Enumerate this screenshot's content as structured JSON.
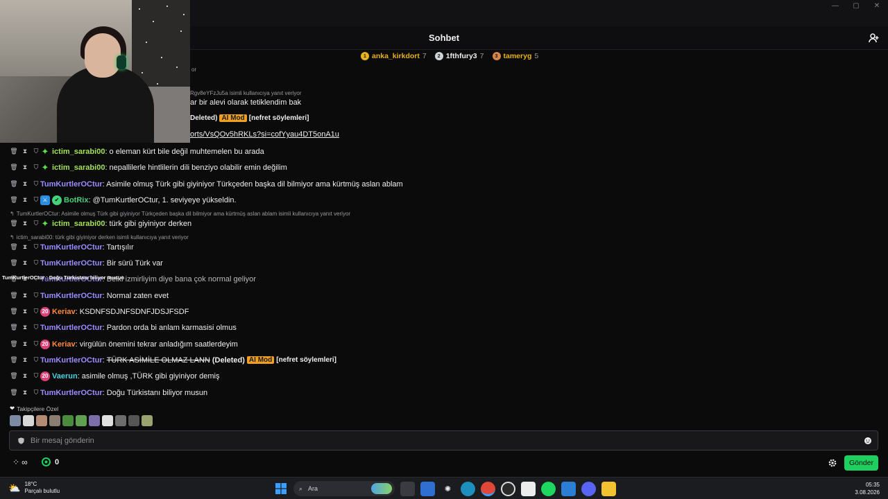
{
  "chat": {
    "title": "Sohbet",
    "leaders": [
      {
        "rank": "1",
        "name": "anka_kirkdort",
        "count": "7",
        "color": "#e8b21c"
      },
      {
        "rank": "2",
        "name": "1fthfury3",
        "count": "7",
        "color": "#cfd3d8"
      },
      {
        "rank": "3",
        "name": "tameryg",
        "count": "5",
        "color": "#d9864a"
      }
    ],
    "partial": {
      "top_tail": "or",
      "reply1": "Rgv8eYFzJu5a isimli kullanıcıya yanıt veriyor",
      "msg1": "ar bir alevi olarak tetiklendim bak",
      "deleted_label": "Deleted)",
      "link": "orts/VsQOv5hRKLs?si=cofYyau4DT5onA1u"
    },
    "messages": [
      {
        "user": "ictim_sarabi00",
        "text": ": o eleman kürt bile değil muhtemelen bu arada",
        "color": "#a4e05a"
      },
      {
        "user": "ictim_sarabi00",
        "text": ": nepallilerle hintlilerin dili benziyo olabilir emin değilim",
        "color": "#a4e05a"
      },
      {
        "user": "TumKurtlerOCtur",
        "text": ": Asimile olmuş Türk gibi giyiniyor Türkçeden başka dil bilmiyor ama kürtmüş aslan ablam",
        "color": "#9b8cff"
      },
      {
        "user": "BotRix",
        "text": ": @TumKurtlerOCtur, 1. seviyeye yükseldin.",
        "color": "#46d17c"
      },
      {
        "user": "ictim_sarabi00",
        "text": ": türk gibi giyiniyor derken",
        "color": "#a4e05a"
      },
      {
        "user": "TumKurtlerOCtur",
        "text": ": Tartışılır",
        "color": "#9b8cff"
      },
      {
        "user": "TumKurtlerOCtur",
        "text": ": Bir sürü Türk var",
        "color": "#9b8cff"
      },
      {
        "user": "TumKurtlerOCtur",
        "text": ": Belki izmirliyim diye bana çok normal geliyor",
        "color": "#9b8cff"
      },
      {
        "user": "TumKurtlerOCtur",
        "text": ": Normal zaten evet",
        "color": "#9b8cff"
      },
      {
        "user": "Keriav",
        "text": ": KSDNFSDJNFSDNFJDSJFSDF",
        "color": "#ff8a3d"
      },
      {
        "user": "TumKurtlerOCtur",
        "text": ": Pardon orda bi anlam karmasisi olmus",
        "color": "#9b8cff"
      },
      {
        "user": "Keriav",
        "text": ": virgülün önemini tekrar anladığım saatlerdeyim",
        "color": "#ff8a3d"
      },
      {
        "user": "TumKurtlerOCtur",
        "text": ":",
        "color": "#9b8cff"
      },
      {
        "user": "Vaerun",
        "text": ": asimile olmuş ,TÜRK gibi giyiniyor demiş",
        "color": "#4fd1e0"
      },
      {
        "user": "TumKurtlerOCtur",
        "text": ": Doğu Türkistanı biliyor musun",
        "color": "#9b8cff"
      }
    ],
    "deleted_msg": {
      "text": "TÜRK ASİMİLE OLMAZ LANN",
      "deleted": "(Deleted)",
      "ai_mod": "AI Mod",
      "reason": "[nefret söylemleri]"
    },
    "replies": [
      "TumKurtlerOCtur: Asimile olmuş Türk gibi giyiniyor Türkçeden başka dil bilmiyor ama kürtmüş aslan ablam isimli kullanıcıya yanıt veriyor",
      "ictim_sarabi00: türk gibi giyiniyor derken isimli kullanıcıya yanıt veriyor"
    ],
    "tooltip": "TumKurtlerOCtur : Doğu Türkistanı biliyor musun",
    "followers_label": "Takipçilere Özel",
    "badge_20": "20",
    "input_placeholder": "Bir mesaj gönderin",
    "points": "0",
    "send_label": "Gönder"
  },
  "taskbar": {
    "temp": "18°C",
    "weather": "Parçalı bulutlu",
    "search": "Ara",
    "time": "05:35",
    "date": "3.08.2026"
  }
}
